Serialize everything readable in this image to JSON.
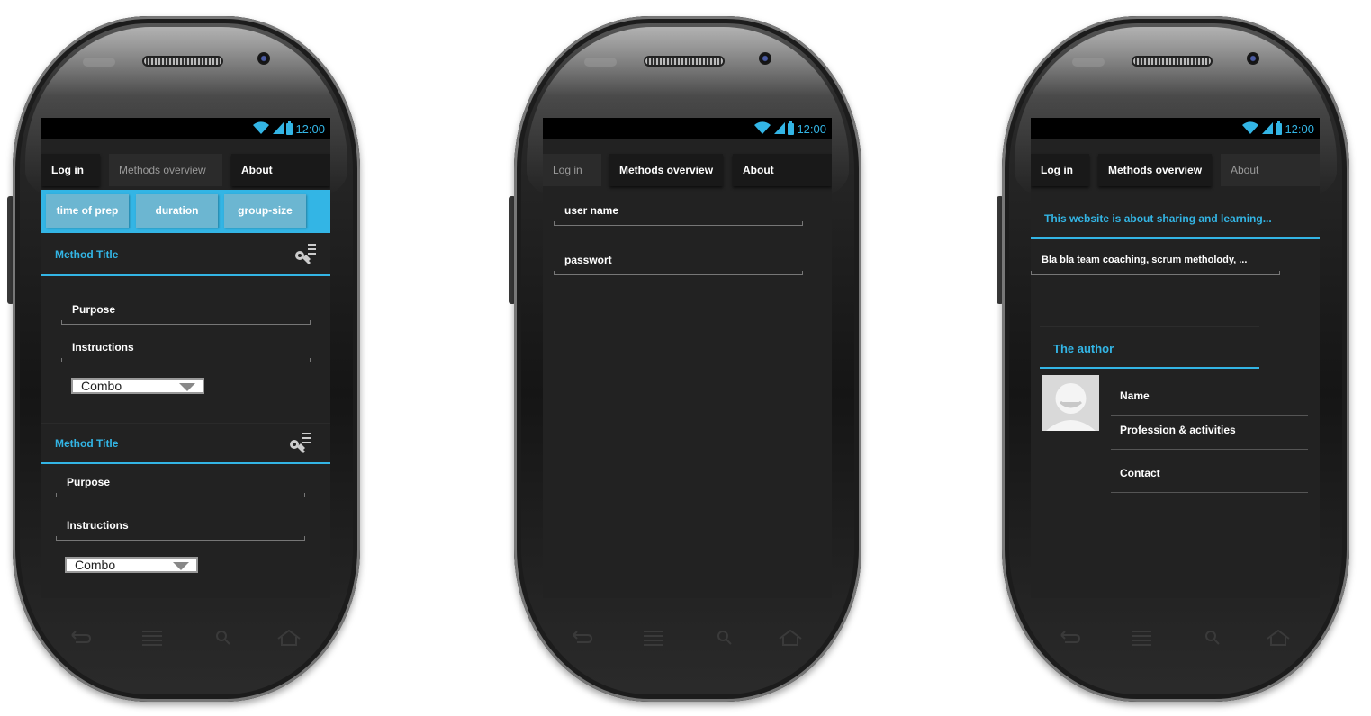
{
  "status": {
    "time": "12:00"
  },
  "phones": [
    {
      "tabs": [
        "Log in",
        "Methods overview",
        "About"
      ],
      "filters": [
        "time of prep",
        "duration",
        "group-size"
      ],
      "methods": [
        {
          "title": "Method Title",
          "purpose": "Purpose",
          "instructions": "Instructions",
          "combo": "Combo"
        },
        {
          "title": "Method Title",
          "purpose": "Purpose",
          "instructions": "Instructions",
          "combo": "Combo"
        }
      ]
    },
    {
      "tabs": [
        "Log in",
        "Methods overview",
        "About"
      ],
      "fields": [
        "user name",
        "passwort"
      ]
    },
    {
      "tabs": [
        "Log in",
        "Methods overview",
        "About"
      ],
      "about_title": "This website is about sharing and learning...",
      "about_text": "Bla bla team coaching, scrum metholody, ...",
      "author_title": "The author",
      "author_fields": [
        "Name",
        "Profession & activities",
        "Contact"
      ]
    }
  ],
  "colors": {
    "accent": "#33b5e5",
    "screen": "#222222",
    "tab_active": "#191919"
  }
}
